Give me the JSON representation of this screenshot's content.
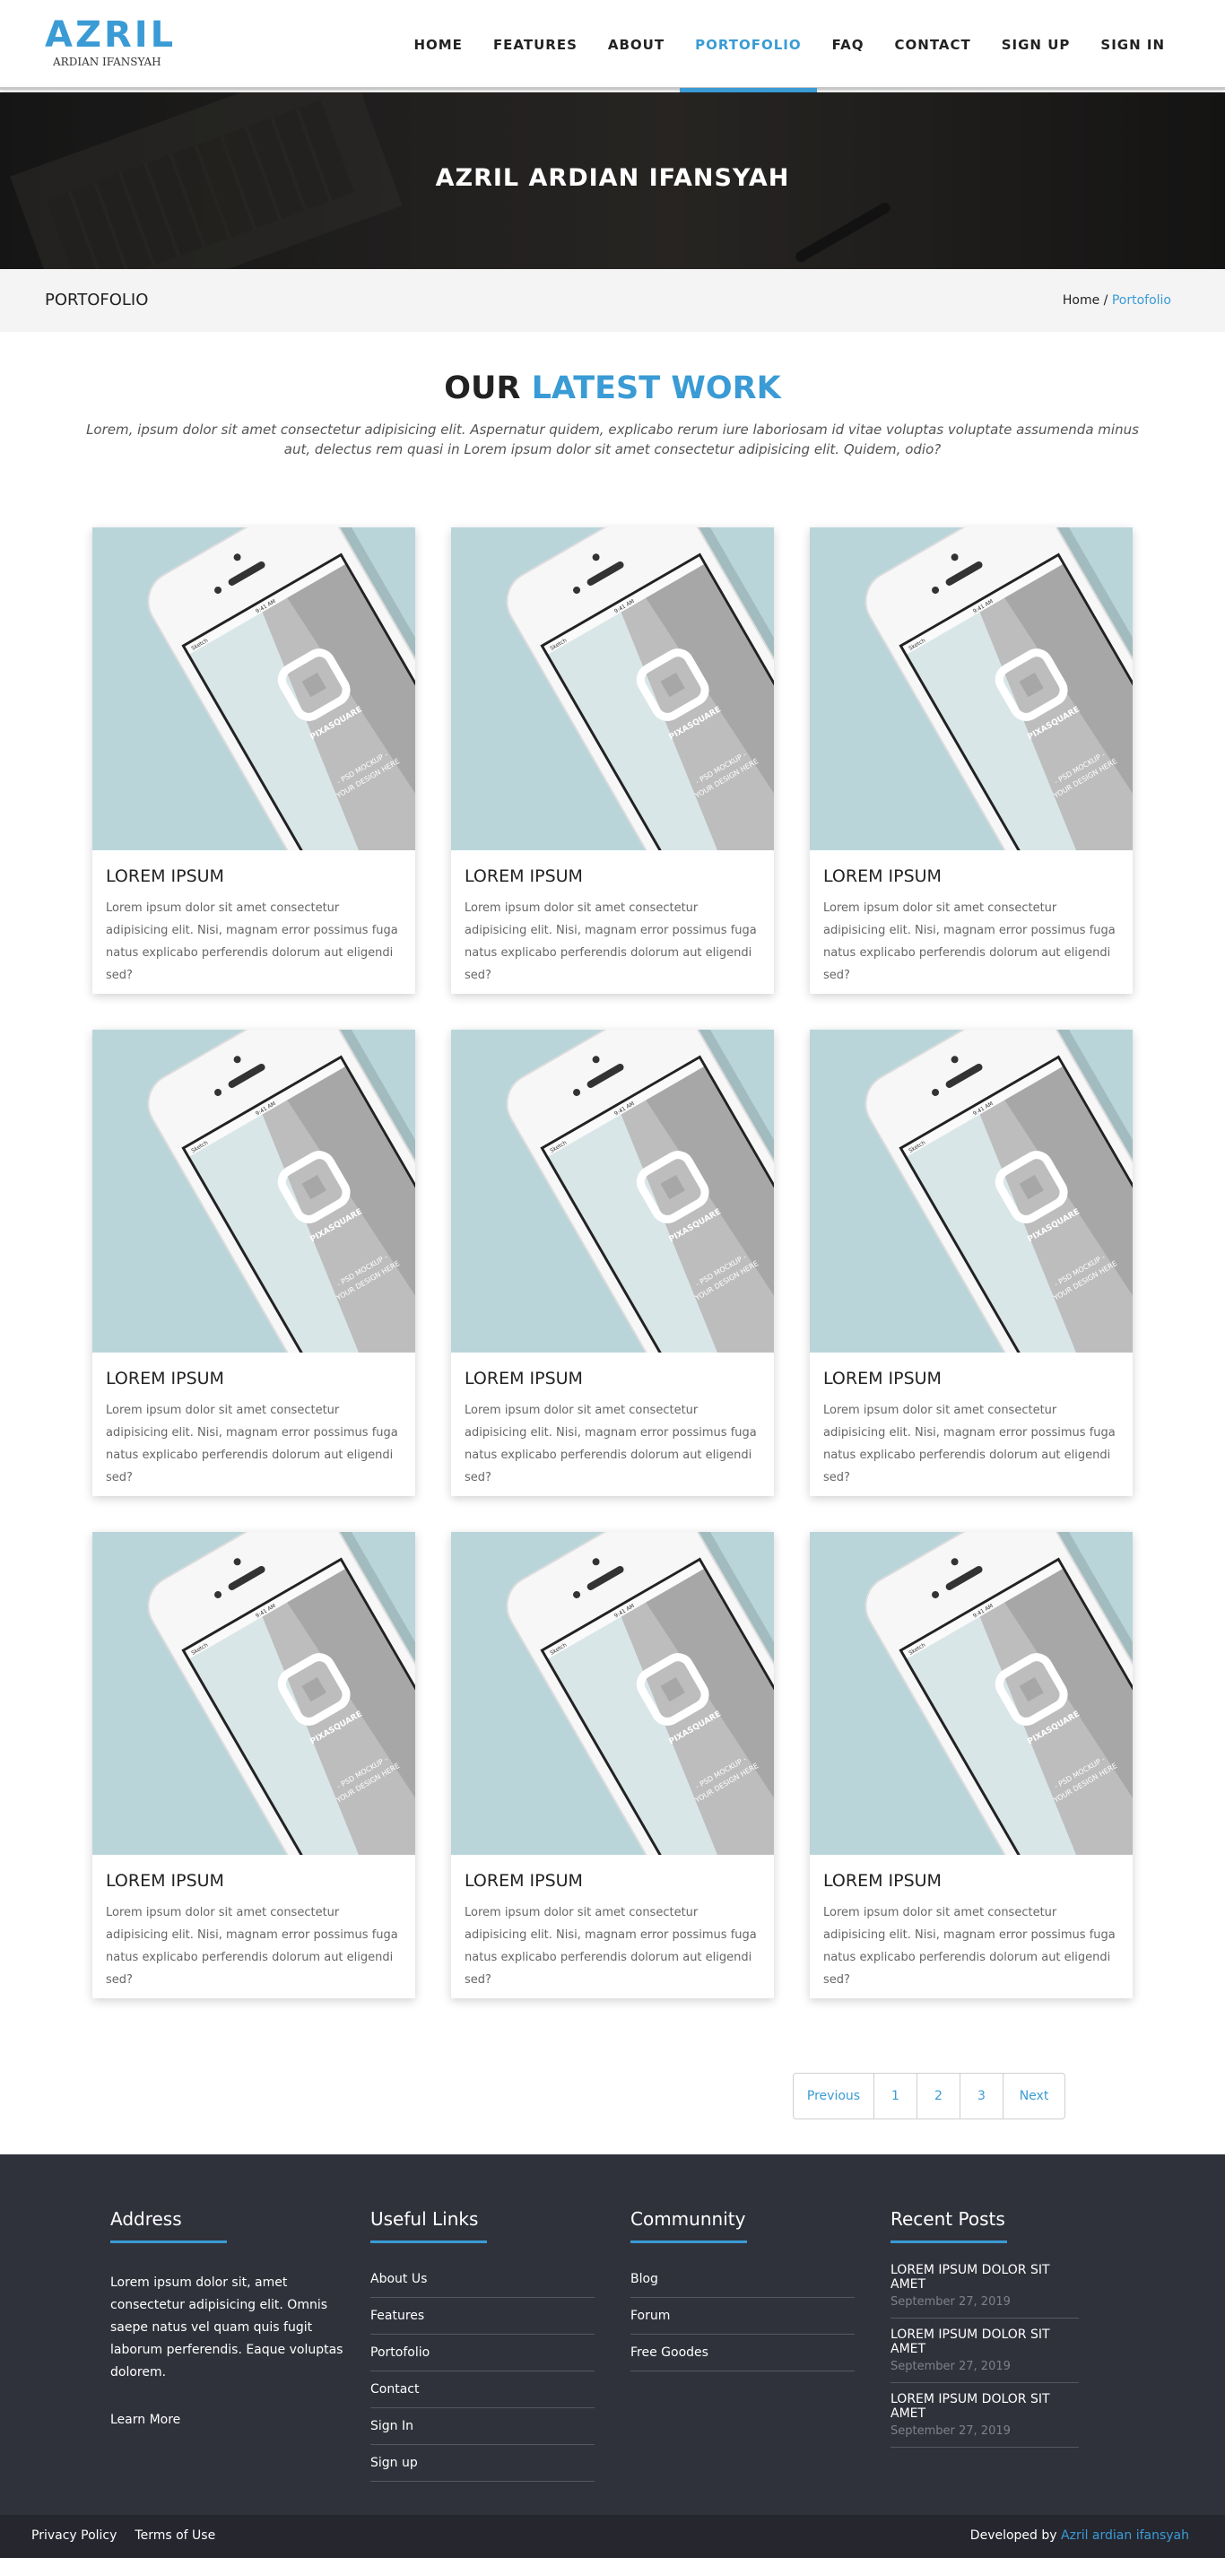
{
  "brand": {
    "name": "AZRIL",
    "subtitle": "ARDIAN IFANSYAH",
    "accent_color": "#3a9bd5"
  },
  "nav": {
    "items": [
      {
        "label": "HOME",
        "active": false
      },
      {
        "label": "FEATURES",
        "active": false
      },
      {
        "label": "ABOUT",
        "active": false
      },
      {
        "label": "PORTOFOLIO",
        "active": true
      },
      {
        "label": "FAQ",
        "active": false
      },
      {
        "label": "CONTACT",
        "active": false
      },
      {
        "label": "SIGN UP",
        "active": false
      },
      {
        "label": "SIGN IN",
        "active": false
      }
    ]
  },
  "hero": {
    "title": "AZRIL ARDIAN IFANSYAH"
  },
  "breadcrumb": {
    "page_title": "PORTOFOLIO",
    "home": "Home",
    "separator": " / ",
    "current": "Portofolio"
  },
  "section": {
    "heading_prefix": "OUR ",
    "heading_accent": "LATEST WORK",
    "description": "Lorem, ipsum dolor sit amet consectetur adipisicing elit. Aspernatur quidem, explicabo rerum iure laboriosam id vitae voluptas voluptate assumenda minus aut, delectus rem quasi in Lorem ipsum dolor sit amet consectetur adipisicing elit. Quidem, odio?"
  },
  "portfolio": [
    {
      "title": "LOREM IPSUM",
      "text": "Lorem ipsum dolor sit amet consectetur adipisicing elit. Nisi, magnam error possimus fuga natus explicabo perferendis dolorum aut eligendi sed?"
    },
    {
      "title": "LOREM IPSUM",
      "text": "Lorem ipsum dolor sit amet consectetur adipisicing elit. Nisi, magnam error possimus fuga natus explicabo perferendis dolorum aut eligendi sed?"
    },
    {
      "title": "LOREM IPSUM",
      "text": "Lorem ipsum dolor sit amet consectetur adipisicing elit. Nisi, magnam error possimus fuga natus explicabo perferendis dolorum aut eligendi sed?"
    },
    {
      "title": "LOREM IPSUM",
      "text": "Lorem ipsum dolor sit amet consectetur adipisicing elit. Nisi, magnam error possimus fuga natus explicabo perferendis dolorum aut eligendi sed?"
    },
    {
      "title": "LOREM IPSUM",
      "text": "Lorem ipsum dolor sit amet consectetur adipisicing elit. Nisi, magnam error possimus fuga natus explicabo perferendis dolorum aut eligendi sed?"
    },
    {
      "title": "LOREM IPSUM",
      "text": "Lorem ipsum dolor sit amet consectetur adipisicing elit. Nisi, magnam error possimus fuga natus explicabo perferendis dolorum aut eligendi sed?"
    },
    {
      "title": "LOREM IPSUM",
      "text": "Lorem ipsum dolor sit amet consectetur adipisicing elit. Nisi, magnam error possimus fuga natus explicabo perferendis dolorum aut eligendi sed?"
    },
    {
      "title": "LOREM IPSUM",
      "text": "Lorem ipsum dolor sit amet consectetur adipisicing elit. Nisi, magnam error possimus fuga natus explicabo perferendis dolorum aut eligendi sed?"
    },
    {
      "title": "LOREM IPSUM",
      "text": "Lorem ipsum dolor sit amet consectetur adipisicing elit. Nisi, magnam error possimus fuga natus explicabo perferendis dolorum aut eligendi sed?"
    }
  ],
  "mockup": {
    "brand": "PIXASQUARE",
    "line1": "- PSD MOCKUP -",
    "line2": "YOUR DESIGN HERE",
    "time": "9:41 AM",
    "carrier": "Sketch"
  },
  "pagination": {
    "prev": "Previous",
    "pages": [
      "1",
      "2",
      "3"
    ],
    "next": "Next"
  },
  "footer": {
    "address": {
      "heading": "Address",
      "text": "Lorem ipsum dolor sit, amet consectetur adipisicing elit. Omnis saepe natus vel quam quis fugit laborum perferendis. Eaque voluptas dolorem.",
      "learn_more": "Learn More"
    },
    "useful_links": {
      "heading": "Useful Links",
      "items": [
        "About Us",
        "Features",
        "Portofolio",
        "Contact",
        "Sign In",
        "Sign up"
      ]
    },
    "community": {
      "heading": "Communnity",
      "items": [
        "Blog",
        "Forum",
        "Free Goodes"
      ]
    },
    "recent_posts": {
      "heading": "Recent Posts",
      "items": [
        {
          "title": "LOREM IPSUM DOLOR SIT AMET",
          "date": "September 27, 2019"
        },
        {
          "title": "LOREM IPSUM DOLOR SIT AMET",
          "date": "September 27, 2019"
        },
        {
          "title": "LOREM IPSUM DOLOR SIT AMET",
          "date": "September 27, 2019"
        }
      ]
    }
  },
  "bottom": {
    "privacy": "Privacy Policy",
    "terms": "Terms of Use",
    "developed_by": "Developed by ",
    "developer": "Azril ardian ifansyah"
  }
}
